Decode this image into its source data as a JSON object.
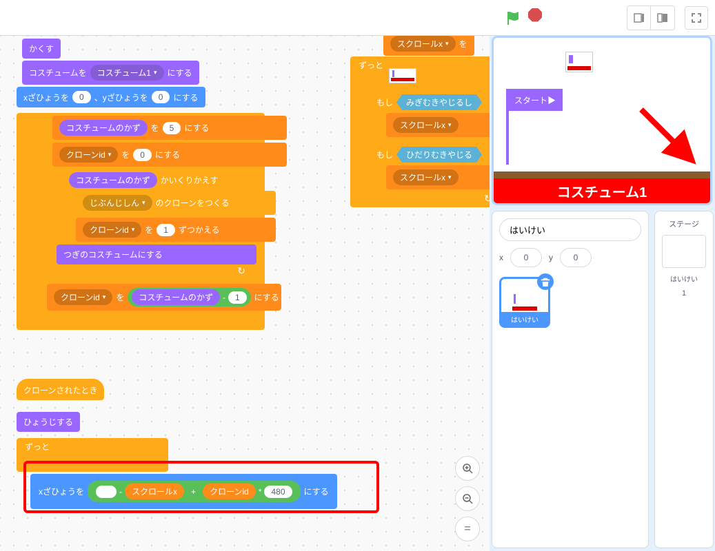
{
  "topbar": {},
  "stage": {
    "flag_label": "スタート▶",
    "banner": "コスチューム1"
  },
  "sprite_panel": {
    "name": "はいけい",
    "x_label": "x",
    "x_value": "0",
    "y_label": "y",
    "y_value": "0",
    "thumb_label": "はいけい"
  },
  "stage_col": {
    "title": "ステージ",
    "label": "はいけい",
    "count": "1"
  },
  "zoom": {
    "in": "+",
    "out": "−",
    "reset": "="
  },
  "blocks": {
    "b0a": "かくす",
    "b1_pre": "コスチュームを",
    "b1_drop": "コスチューム1",
    "b1_post": "にする",
    "b2_pre": "xざひょうを",
    "b2_val1": "0",
    "b2_mid": "、yざひょうを",
    "b2_val2": "0",
    "b2_post": "にする",
    "b3_rep": "コスチュームのかず",
    "b3_mid": "を",
    "b3_val": "5",
    "b3_post": "にする",
    "b4_drop": "クローンid",
    "b4_mid": "を",
    "b4_val": "0",
    "b4_post": "にする",
    "b5_rep": "コスチュームのかず",
    "b5_post": "かいくりかえす",
    "b6_drop": "じぶんじしん",
    "b6_post": "のクローンをつくる",
    "b7_drop": "クローンid",
    "b7_mid": "を",
    "b7_val": "1",
    "b7_post": "ずつかえる",
    "b8": "つぎのコスチュームにする",
    "b9_drop": "クローンid",
    "b9_mid": "を",
    "b9_rep": "コスチュームのかず",
    "b9_op": "-",
    "b9_val": "1",
    "b9_post": "にする",
    "b10": "クローンされたとき",
    "b11": "ひょうじする",
    "b12": "ずっと",
    "b13_pre": "xざひょうを",
    "b13_op1": "-",
    "b13_rep1": "スクロールx",
    "b13_op2": "+",
    "b13_rep2": "クローンid",
    "b13_op3": "*",
    "b13_val": "480",
    "b13_post": "にする",
    "r1_drop": "スクロールx",
    "r1_mid": "を",
    "r2": "ずっと",
    "r3": "もし",
    "r3_hex": "みぎむきやじるし",
    "r4_drop": "スクロールx",
    "r5": "もし",
    "r5_hex": "ひだりむきやじる",
    "r6_drop": "スクロールx"
  }
}
